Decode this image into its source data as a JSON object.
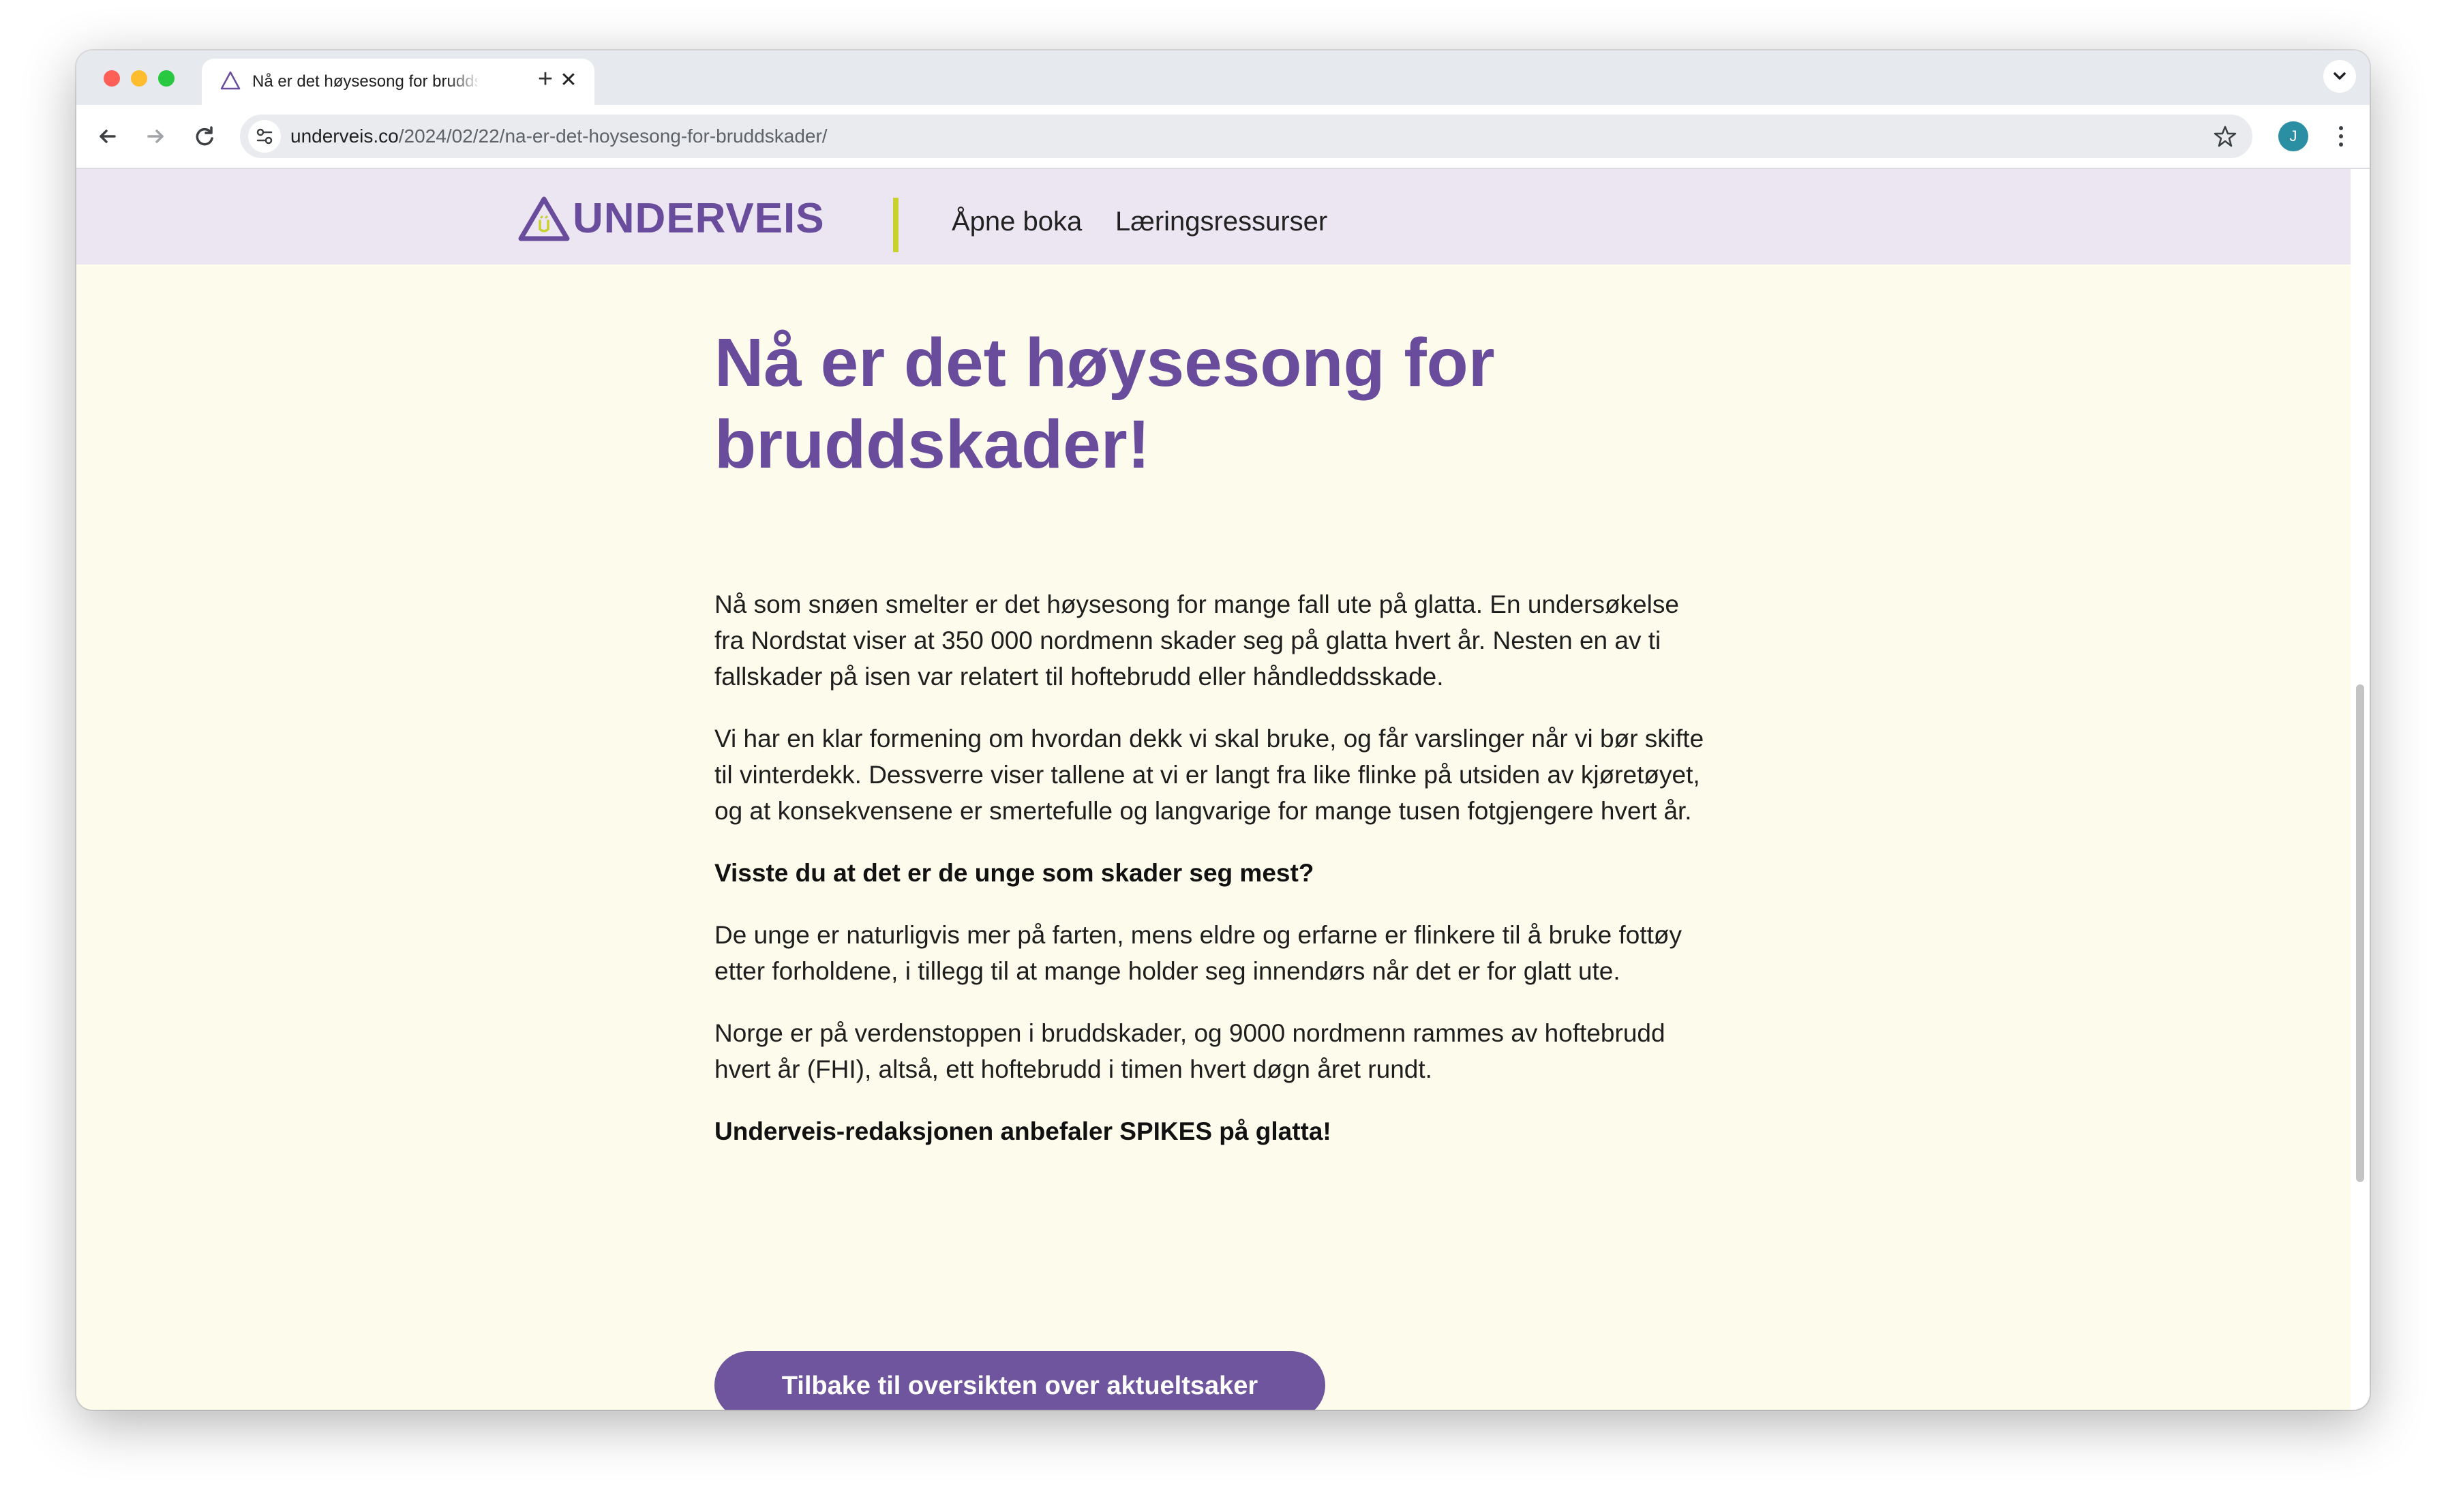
{
  "browser": {
    "tab": {
      "title": "Nå er det høysesong for bruddskader!"
    },
    "url": {
      "host": "underveis.co",
      "path": "/2024/02/22/na-er-det-hoysesong-for-bruddskader/"
    },
    "profile_initial": "J"
  },
  "site": {
    "logo_text": "UNDERVEIS",
    "nav": [
      "Åpne boka",
      "Læringsressurser"
    ]
  },
  "article": {
    "title": "Nå er det høysesong for bruddskader!",
    "paragraphs": [
      "Nå som snøen smelter er det høysesong for mange fall ute på glatta. En undersøkelse fra Nordstat viser at 350 000 nordmenn skader seg på glatta hvert år. Nesten en av ti fallskader på isen var relatert til hoftebrudd eller håndleddsskade.",
      "Vi har en klar formening om hvordan dekk vi skal bruke, og får varslinger når vi bør skifte til vinterdekk. Dessverre viser tallene at vi er langt fra like flinke på utsiden av kjøretøyet, og at konsekvensene er smertefulle og langvarige for mange tusen fotgjengere hvert år.",
      "Visste du at det er de unge som skader seg mest?",
      "De unge er naturligvis mer på farten, mens eldre og erfarne er flinkere til å bruke fottøy etter forholdene, i tillegg til at mange holder seg innendørs når det er for glatt ute.",
      "Norge er på verdenstoppen i bruddskader, og 9000 nordmenn rammes av hoftebrudd hvert år (FHI), altså, ett hoftebrudd i timen hvert døgn året rundt.",
      "Underveis-redaksjonen anbefaler SPIKES på glatta!"
    ],
    "back_button": "Tilbake til oversikten over aktueltsaker"
  },
  "colors": {
    "brand_purple": "#6a4c9c",
    "button_purple": "#6f559d",
    "header_bg": "#ebe6f1",
    "page_bg": "#fdfcec",
    "divider_yellow": "#c9d12e"
  }
}
